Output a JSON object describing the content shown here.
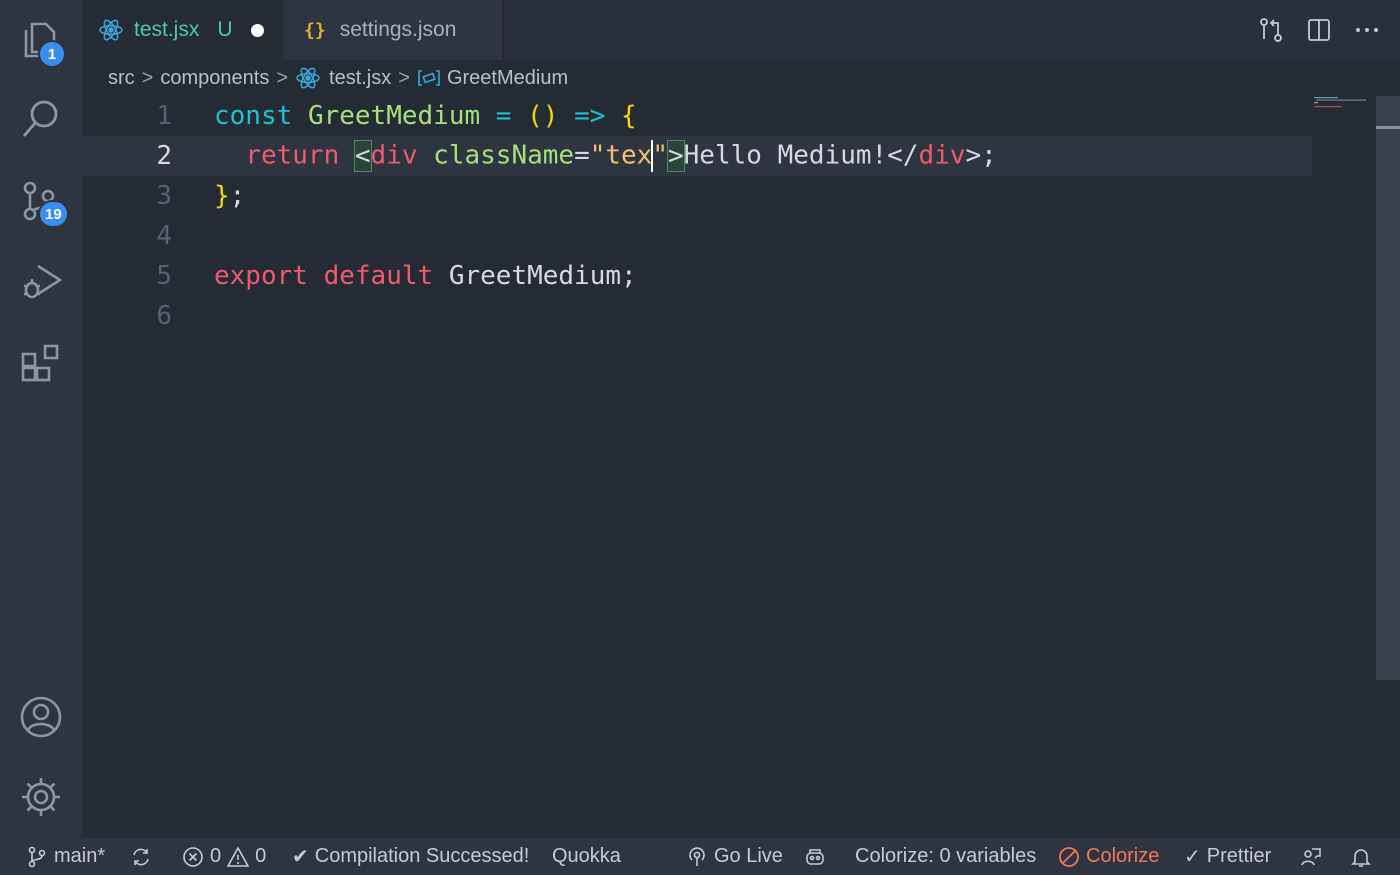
{
  "activity_bar": {
    "explorer_badge": "1",
    "source_control_badge": "19"
  },
  "tabs": [
    {
      "label": "test.jsx",
      "status": "U",
      "dirty": true,
      "active": true
    },
    {
      "label": "settings.json",
      "icon_text": "{}",
      "active": false
    }
  ],
  "breadcrumb": {
    "items": [
      "src",
      "components",
      "test.jsx",
      "GreetMedium"
    ]
  },
  "editor": {
    "line_numbers": [
      "1",
      "2",
      "3",
      "4",
      "5",
      "6"
    ],
    "current_line": "2",
    "lines": {
      "l1": {
        "kw": "const",
        "name": "GreetMedium",
        "eq": "=",
        "parens": "()",
        "arrow": "=>",
        "brace": "{"
      },
      "l2": {
        "ret": "return",
        "lt": "<",
        "tag_open": "div",
        "attr": "className",
        "eq": "=",
        "str": "\"tex",
        "quote": "\"",
        "gt": ">",
        "text": "Hello Medium!",
        "close_lt": "</",
        "tag_close": "div",
        "end": ">;"
      },
      "l3": {
        "brace": "}",
        "semi": ";"
      },
      "l5": {
        "exp": "export",
        "def": "default",
        "name": "GreetMedium",
        "semi": ";"
      }
    }
  },
  "status_bar": {
    "branch": "main*",
    "errors": "0",
    "warnings": "0",
    "compilation": "Compilation Successed!",
    "quokka": "Quokka",
    "go_live": "Go Live",
    "colorize_vars": "Colorize: 0 variables",
    "colorize": "Colorize",
    "prettier": "Prettier"
  },
  "colors": {
    "accent_badge": "#3a8ef0",
    "git_untracked": "#4fcaa0",
    "colorize_warning": "#f07858"
  }
}
